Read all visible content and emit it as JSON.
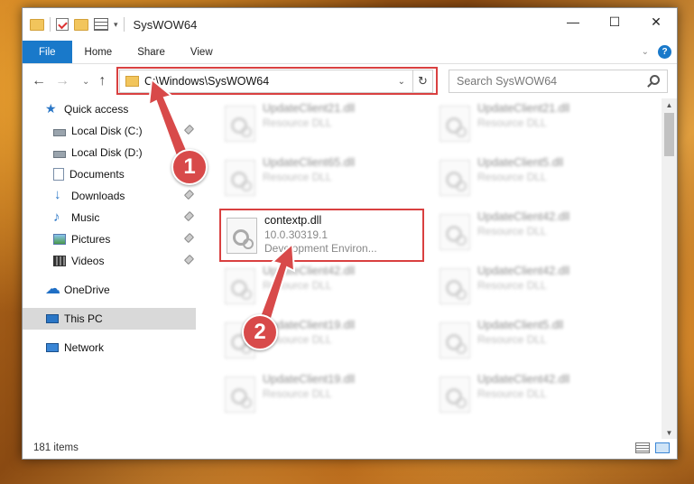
{
  "window": {
    "title": "SysWOW64",
    "controls": {
      "minimize": "—",
      "maximize": "☐",
      "close": "✕"
    }
  },
  "ribbon": {
    "tabs": [
      "File",
      "Home",
      "Share",
      "View"
    ],
    "help": "?"
  },
  "nav": {
    "back": "←",
    "forward": "→",
    "recent": "⌄",
    "up": "↑",
    "address": "C:\\Windows\\SysWOW64",
    "search_placeholder": "Search SysWOW64"
  },
  "sidebar": {
    "items": [
      {
        "label": "Quick access",
        "icon": "star-icon"
      },
      {
        "label": "Local Disk (C:)",
        "icon": "drive-icon",
        "pinned": true
      },
      {
        "label": "Local Disk (D:)",
        "icon": "drive-icon"
      },
      {
        "label": "Documents",
        "icon": "documents-icon"
      },
      {
        "label": "Downloads",
        "icon": "downloads-icon",
        "pinned": true
      },
      {
        "label": "Music",
        "icon": "music-icon",
        "pinned": true
      },
      {
        "label": "Pictures",
        "icon": "pictures-icon",
        "pinned": true
      },
      {
        "label": "Videos",
        "icon": "videos-icon",
        "pinned": true
      },
      {
        "label": "OneDrive",
        "icon": "onedrive-icon"
      },
      {
        "label": "This PC",
        "icon": "pc-icon",
        "selected": true
      },
      {
        "label": "Network",
        "icon": "network-icon"
      }
    ]
  },
  "files": {
    "left": [
      {
        "name": "UpdateClient21.dll",
        "sub": "Resource DLL"
      },
      {
        "name": "UpdateClient65.dll",
        "sub": "Resource DLL"
      },
      {
        "name": "contextp.dll",
        "sub": "10.0.30319.1",
        "sub2": "Development Environ..."
      },
      {
        "name": "UpdateClient42.dll",
        "sub": "Resource DLL"
      },
      {
        "name": "UpdateClient19.dll",
        "sub": "Resource DLL"
      },
      {
        "name": "UpdateClient19.dll",
        "sub": "Resource DLL"
      }
    ],
    "right": [
      {
        "name": "UpdateClient21.dll",
        "sub": "Resource DLL"
      },
      {
        "name": "UpdateClient5.dll",
        "sub": "Resource DLL"
      },
      {
        "name": "UpdateClient42.dll",
        "sub": "Resource DLL"
      },
      {
        "name": "UpdateClient42.dll",
        "sub": "Resource DLL"
      },
      {
        "name": "UpdateClient5.dll",
        "sub": "Resource DLL"
      },
      {
        "name": "UpdateClient42.dll",
        "sub": "Resource DLL"
      }
    ]
  },
  "status": {
    "item_count": "181 items"
  },
  "callouts": {
    "one": "1",
    "two": "2",
    "color": "#d84a4a"
  }
}
